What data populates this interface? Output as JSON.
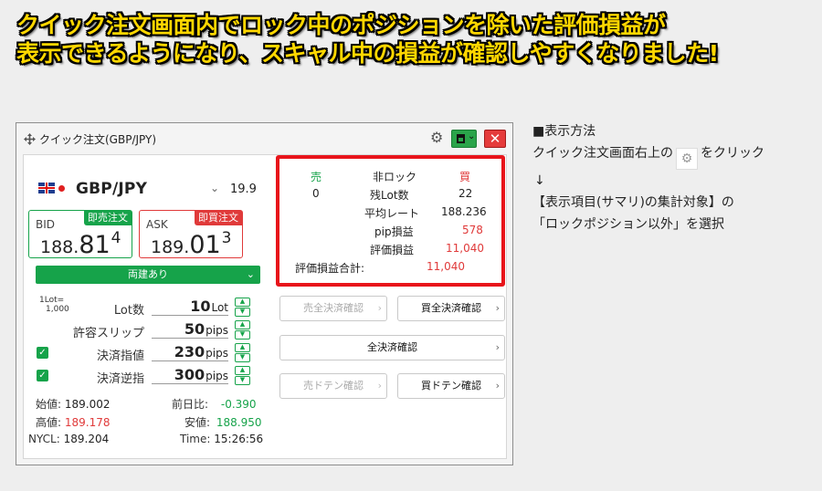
{
  "headline": {
    "line1": "クイック注文画面内でロック中のポジションを除いた評価損益が",
    "line2": "表示できるようになり、スキャル中の損益が確認しやすくなりました!"
  },
  "window": {
    "title": "クイック注文(GBP/JPY)",
    "close_glyph": "✕",
    "gear_glyph": "⚙",
    "layout_chevron": "⌄"
  },
  "pair": {
    "name": "GBP/JPY",
    "chevron": "⌄",
    "spread": "19.9"
  },
  "bid": {
    "label": "BID",
    "tag": "即売注文",
    "price_small": "188.",
    "price_big": "81",
    "price_sup": "4"
  },
  "ask": {
    "label": "ASK",
    "tag": "即買注文",
    "price_small": "189.",
    "price_big": "01",
    "price_sup": "3"
  },
  "mode_bar": {
    "label": "両建あり",
    "chevron": "⌄"
  },
  "lot_note": {
    "line1": "1Lot=",
    "line2": "1,000"
  },
  "fields": {
    "lot": {
      "label": "Lot数",
      "value": "10",
      "unit": "Lot"
    },
    "slip": {
      "label": "許容スリップ",
      "value": "50",
      "unit": "pips"
    },
    "limit": {
      "label": "決済指値",
      "value": "230",
      "unit": "pips"
    },
    "stop": {
      "label": "決済逆指",
      "value": "300",
      "unit": "pips"
    }
  },
  "stepper": {
    "up": "▲",
    "down": "▼"
  },
  "check_glyph": "✓",
  "stats": {
    "open_k": "始値:",
    "open_v": "189.002",
    "prev_k": "前日比:",
    "prev_v": "-0.390",
    "high_k": "高値:",
    "high_v": "189.178",
    "low_k": "安値:",
    "low_v": "188.950",
    "nycl_k": "NYCL:",
    "nycl_v": "189.204",
    "time_k": "Time:",
    "time_v": "15:26:56"
  },
  "positions": {
    "sell_h": "売",
    "nolock_h": "非ロック",
    "buy_h": "買",
    "sell_lots": "0",
    "lots_label": "残Lot数",
    "buy_lots": "22",
    "avg_label": "平均レート",
    "avg_value": "188.236",
    "pip_label": "pip損益",
    "pip_value": "578",
    "eval_label": "評価損益",
    "eval_value": "11,040",
    "total_label": "評価損益合計:",
    "total_value": "11,040"
  },
  "buttons": {
    "sell_all": "売全決済確認",
    "buy_all": "買全決済確認",
    "all": "全決済確認",
    "sell_doten": "売ドテン確認",
    "buy_doten": "買ドテン確認",
    "chevron": "›"
  },
  "note": {
    "heading": "■表示方法",
    "line1_a": "クイック注文画面右上の",
    "line1_b": "をクリック",
    "arrow": "↓",
    "line2": "【表示項目(サマリ)の集計対象】の",
    "line3": "「ロックポジション以外」を選択"
  },
  "colors": {
    "headline": "#ffd700",
    "green": "#16a34a",
    "red": "#e03a3a",
    "highlight_border": "#e8151b"
  }
}
